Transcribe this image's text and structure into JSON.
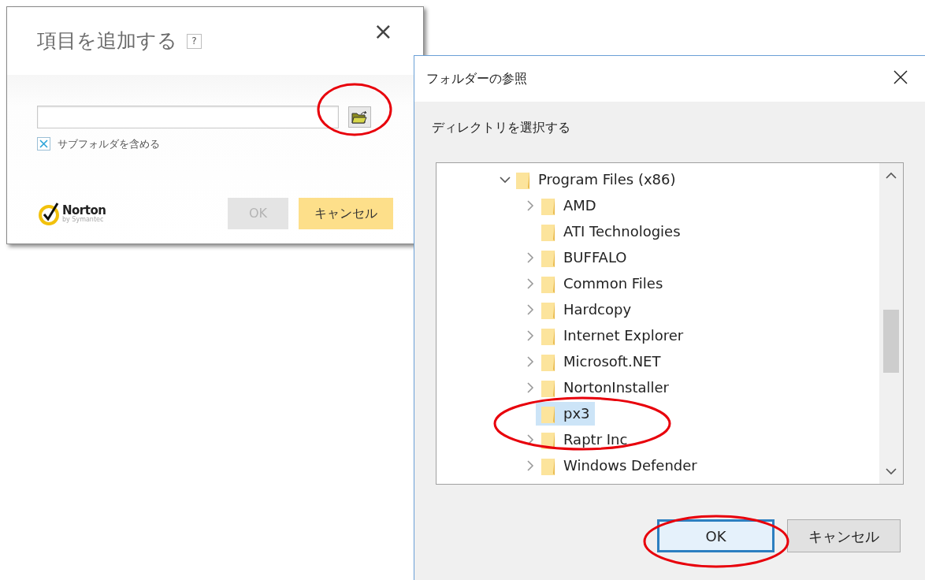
{
  "add_dialog": {
    "title": "項目を追加する",
    "help": "?",
    "close": "×",
    "include_subfolders": {
      "label": "サブフォルダを含める",
      "checked": true
    },
    "logo": {
      "name": "Norton",
      "tagline": "by Symantec"
    },
    "buttons": [
      {
        "label": "OK",
        "disabled": true,
        "kind": "secondary"
      },
      {
        "label": "キャンセル",
        "disabled": false,
        "kind": "primary"
      }
    ]
  },
  "browse_dialog": {
    "title": "フォルダーの参照",
    "instruction": "ディレクトリを選択する",
    "tree": [
      {
        "label": "Program Files (x86)",
        "kind": "branch",
        "expanded": true,
        "selected": false,
        "children": [
          {
            "label": "AMD",
            "kind": "branch",
            "expanded": false,
            "selected": false
          },
          {
            "label": "ATI Technologies",
            "kind": "leaf",
            "selected": false
          },
          {
            "label": "BUFFALO",
            "kind": "branch",
            "expanded": false,
            "selected": false
          },
          {
            "label": "Common Files",
            "kind": "branch",
            "expanded": false,
            "selected": false
          },
          {
            "label": "Hardcopy",
            "kind": "branch",
            "expanded": false,
            "selected": false
          },
          {
            "label": "Internet Explorer",
            "kind": "branch",
            "expanded": false,
            "selected": false
          },
          {
            "label": "Microsoft.NET",
            "kind": "branch",
            "expanded": false,
            "selected": false
          },
          {
            "label": "NortonInstaller",
            "kind": "branch",
            "expanded": false,
            "selected": false
          },
          {
            "label": "px3",
            "kind": "leaf",
            "selected": true
          },
          {
            "label": "Raptr Inc",
            "kind": "branch",
            "expanded": false,
            "selected": false
          },
          {
            "label": "Windows Defender",
            "kind": "branch",
            "expanded": false,
            "selected": false
          }
        ]
      }
    ],
    "buttons": [
      {
        "label": "OK",
        "default": true
      },
      {
        "label": "キャンセル",
        "default": false
      }
    ]
  }
}
